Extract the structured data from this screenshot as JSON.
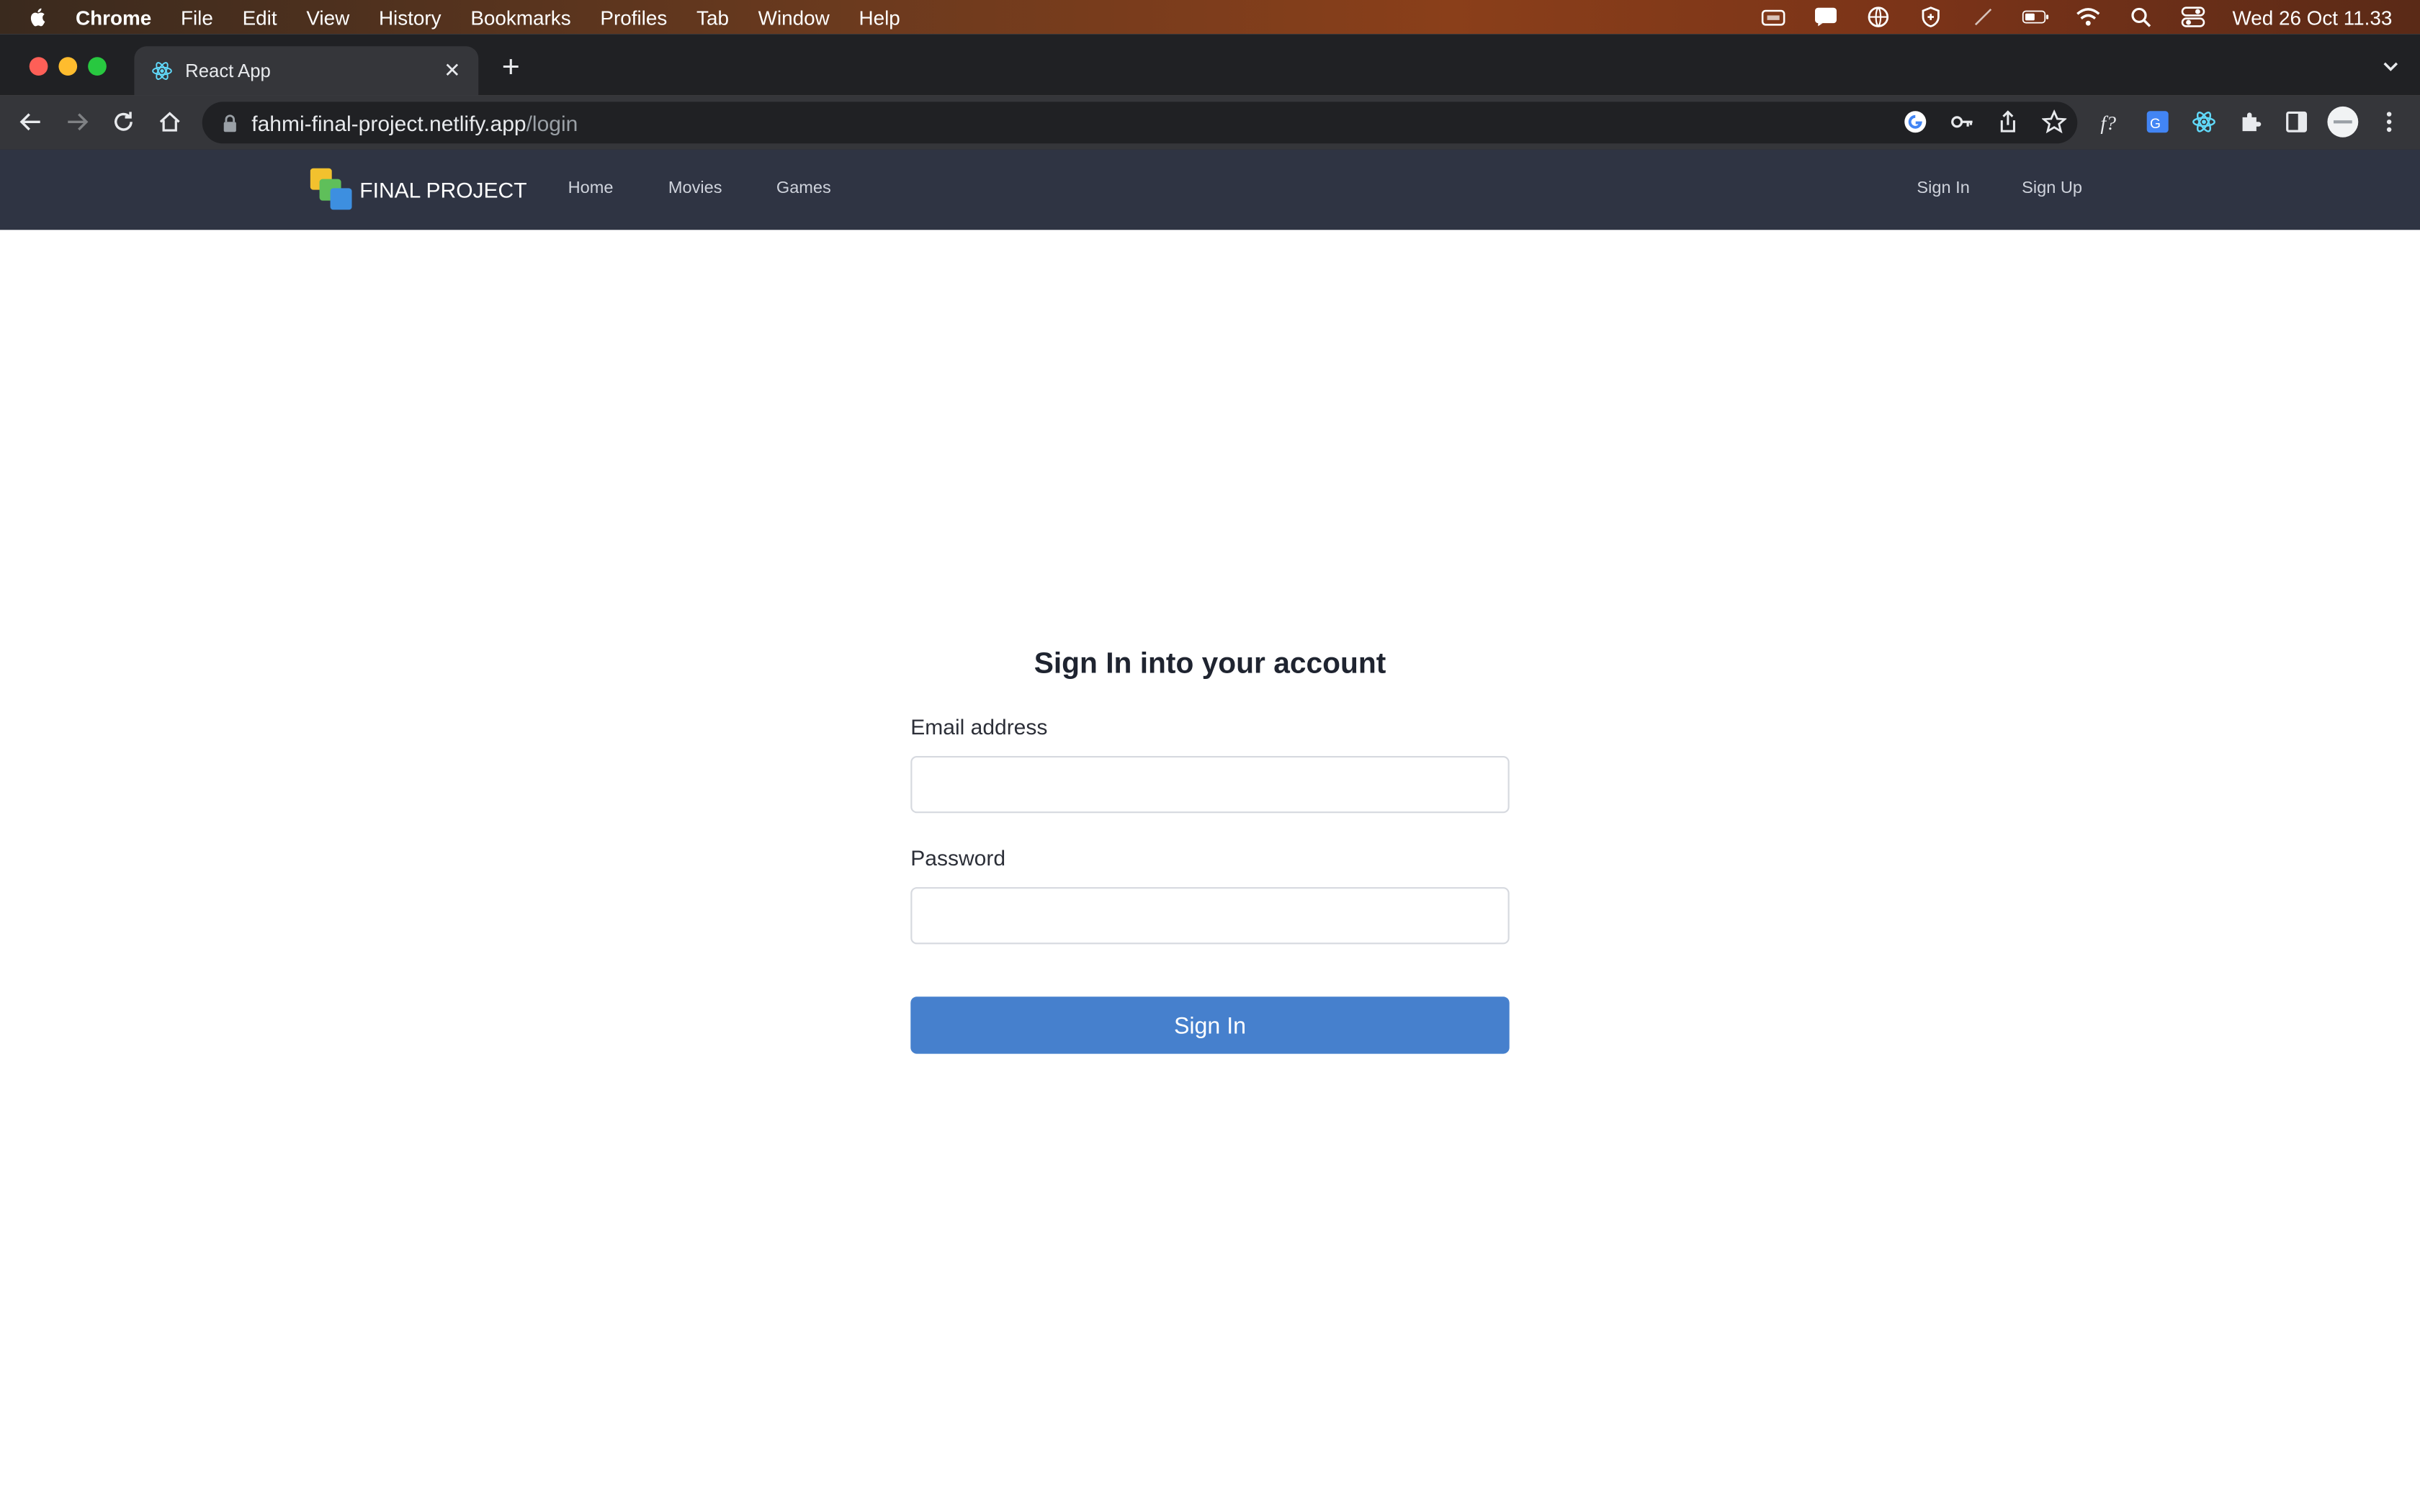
{
  "menubar": {
    "app": "Chrome",
    "items": [
      "File",
      "Edit",
      "View",
      "History",
      "Bookmarks",
      "Profiles",
      "Tab",
      "Window",
      "Help"
    ],
    "clock": "Wed 26 Oct  11.33"
  },
  "browser": {
    "tab_title": "React App",
    "url_host": "fahmi-final-project.netlify.app",
    "url_path": "/login"
  },
  "navbar": {
    "brand": "FINAL PROJECT",
    "links": [
      "Home",
      "Movies",
      "Games"
    ],
    "auth_links": [
      "Sign In",
      "Sign Up"
    ]
  },
  "login": {
    "heading": "Sign In into your account",
    "email_label": "Email address",
    "email_value": "",
    "password_label": "Password",
    "password_value": "",
    "submit_label": "Sign In"
  },
  "colors": {
    "navbar_bg": "#2f3443",
    "button_bg": "#4680cd",
    "brand_logo": [
      "#f2c12e",
      "#5fbf5a",
      "#3d8fe0"
    ]
  }
}
